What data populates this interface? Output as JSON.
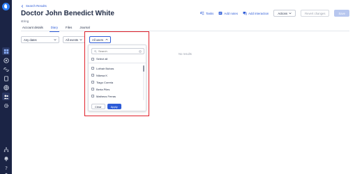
{
  "nav": {
    "icons": [
      "logo-icon",
      "dashboard-icon",
      "target-icon",
      "link-icon",
      "document-icon",
      "globe-icon",
      "people-icon",
      "settings-icon",
      "org-icon",
      "bell-icon",
      "help-icon",
      "user-icon"
    ]
  },
  "header": {
    "back_label": "Search Results",
    "title": "Doctor John Benedict White",
    "subtitle": "string"
  },
  "toolbar": {
    "tasks_label": "Tasks",
    "add_notes_label": "Add notes",
    "add_interaction_label": "Add interaction",
    "actions_label": "Actions",
    "revert_label": "Revert changes",
    "save_label": "Save"
  },
  "tabs": [
    {
      "label": "Account details",
      "active": false
    },
    {
      "label": "Diary",
      "active": true
    },
    {
      "label": "Files",
      "active": false
    },
    {
      "label": "Journal",
      "active": false
    }
  ],
  "filters": {
    "dates": "Any dates",
    "events": "All events",
    "users": "All users"
  },
  "main": {
    "no_results": "No results"
  },
  "user_popover": {
    "search_placeholder": "Search",
    "select_all_label": "Select all",
    "users": [
      "Lothair Bulvas",
      "Nikesa K",
      "Tiago Correia",
      "Berta Piles",
      "Matheus Ferras"
    ],
    "clear_label": "Clear",
    "apply_label": "Apply"
  },
  "colors": {
    "nav_bg": "#1b2445",
    "accent": "#2d5bd7",
    "highlight": "#e0202a"
  }
}
